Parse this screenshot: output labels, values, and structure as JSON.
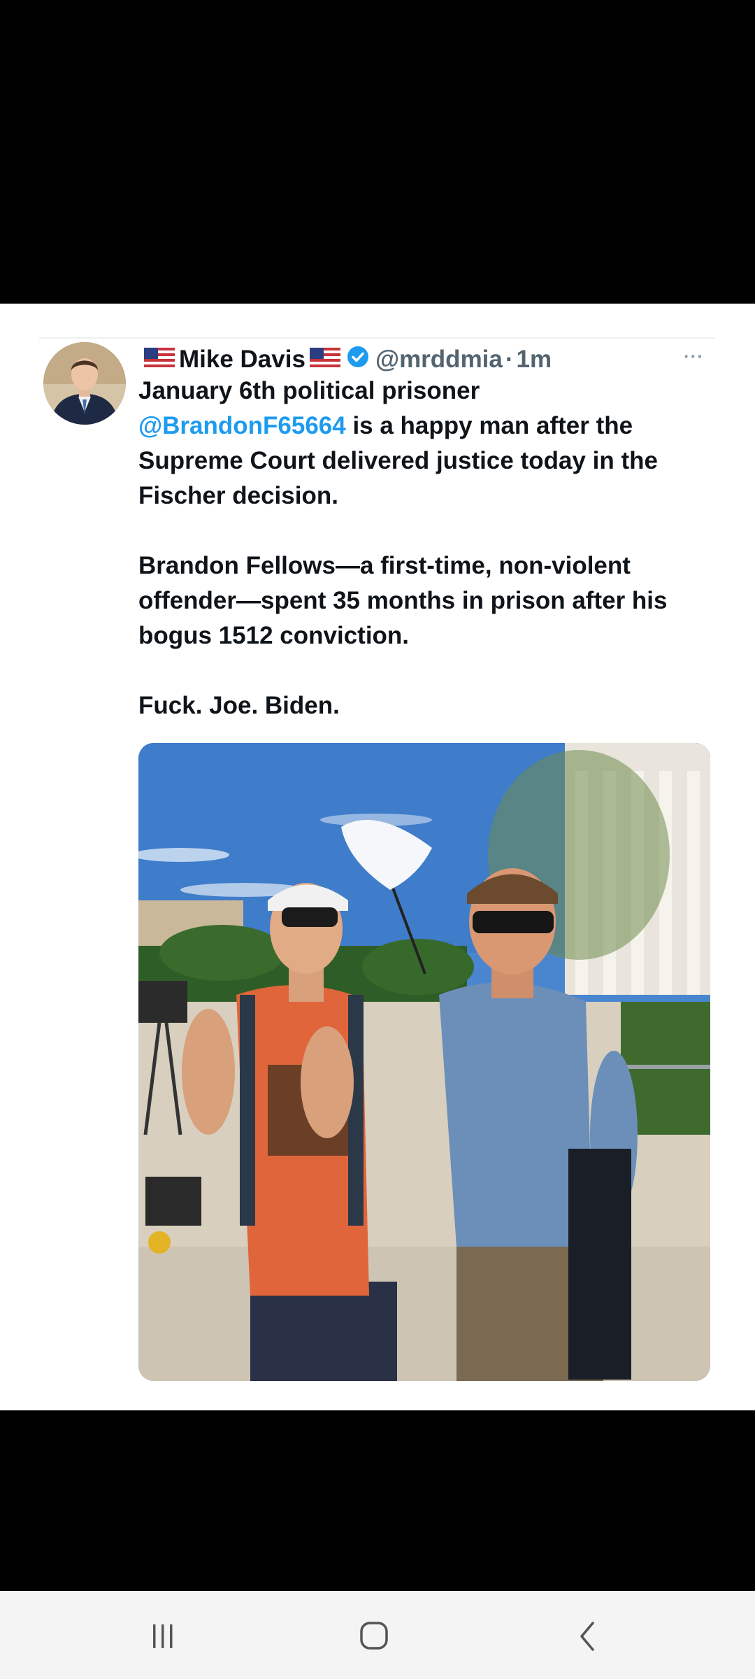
{
  "tweet": {
    "author_name": "Mike Davis",
    "author_handle": "@mrddmia",
    "separator": "·",
    "time": "1m",
    "more_label": "···",
    "text_intro": "January 6th political prisoner",
    "mention": "@BrandonF65664",
    "text_after_mention": " is a happy man after the Supreme Court delivered justice today in the Fischer decision.",
    "paragraph_2": "Brandon Fellows—a first-time, non-violent offender—spent 35 months in prison after his bogus 1512 conviction.",
    "paragraph_3": "Fuck. Joe. Biden."
  },
  "icons": {
    "flag_left": "us-flag-icon",
    "flag_right": "us-flag-icon",
    "verified": "verified-badge-icon",
    "recents": "recent-apps-icon",
    "home": "home-icon",
    "back": "back-icon"
  },
  "colors": {
    "background": "#000000",
    "card": "#ffffff",
    "text": "#0f1419",
    "muted": "#536471",
    "link": "#1d9bf0",
    "navbar": "#f4f4f4"
  }
}
